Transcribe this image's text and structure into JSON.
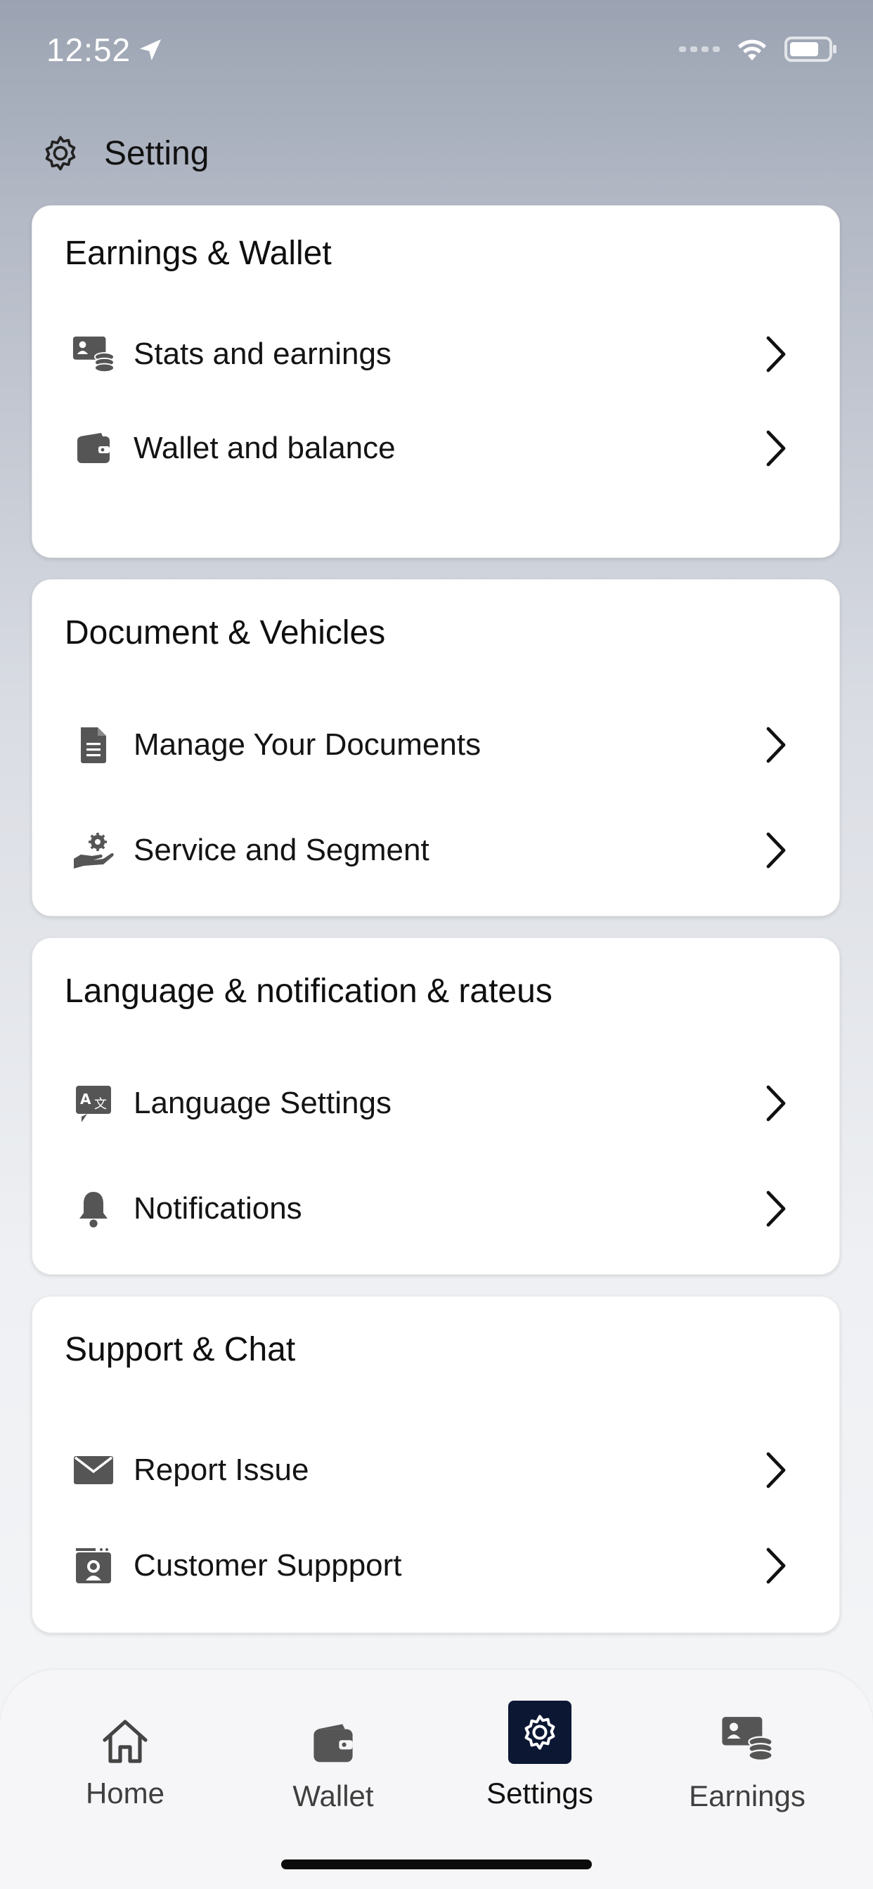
{
  "status_bar": {
    "time": "12:52"
  },
  "header": {
    "title": "Setting"
  },
  "sections": [
    {
      "title": "Earnings & Wallet",
      "items": [
        {
          "label": "Stats and earnings",
          "icon": "stats-earnings-icon"
        },
        {
          "label": "Wallet and balance",
          "icon": "wallet-icon"
        }
      ]
    },
    {
      "title": "Document & Vehicles",
      "items": [
        {
          "label": "Manage Your Documents",
          "icon": "document-icon"
        },
        {
          "label": "Service and Segment",
          "icon": "service-hand-gear-icon"
        }
      ]
    },
    {
      "title": "Language & notification & rateus",
      "items": [
        {
          "label": "Language Settings",
          "icon": "language-icon"
        },
        {
          "label": "Notifications",
          "icon": "bell-icon"
        }
      ]
    },
    {
      "title": "Support & Chat",
      "items": [
        {
          "label": "Report Issue",
          "icon": "envelope-icon"
        },
        {
          "label": "Customer Suppport",
          "icon": "customer-support-icon"
        }
      ]
    }
  ],
  "bottom_nav": {
    "items": [
      {
        "label": "Home",
        "icon": "home-icon"
      },
      {
        "label": "Wallet",
        "icon": "wallet-icon"
      },
      {
        "label": "Settings",
        "icon": "gear-icon",
        "active": true
      },
      {
        "label": "Earnings",
        "icon": "earnings-icon"
      }
    ]
  },
  "colors": {
    "active_tab_bg": "#0b1733",
    "icon_gray": "#555555",
    "card_bg": "#ffffff"
  }
}
